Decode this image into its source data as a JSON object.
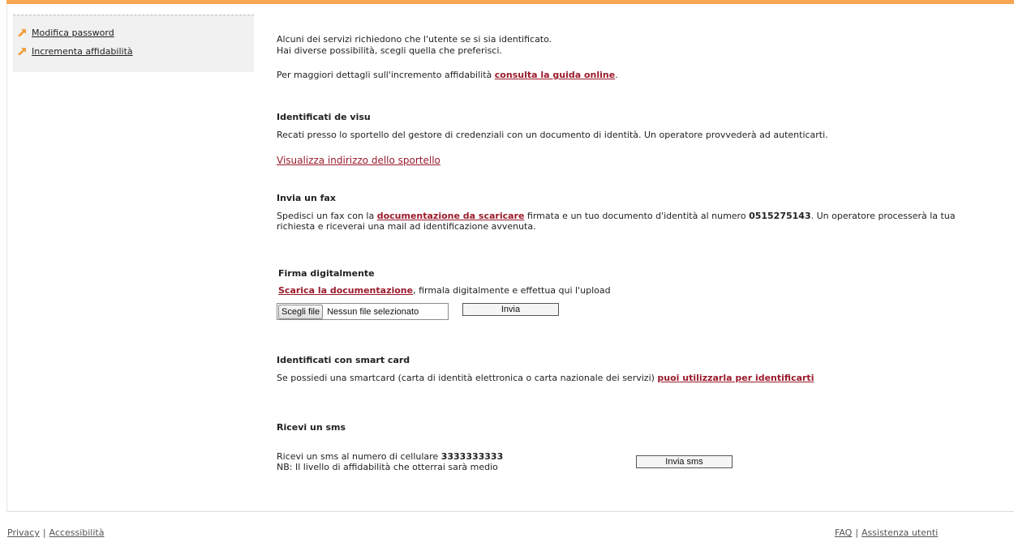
{
  "sidebar": {
    "items": [
      {
        "label": "Modifica password"
      },
      {
        "label": "Incrementa affidabilità"
      }
    ]
  },
  "intro": {
    "line1": "Alcuni dei servizi richiedono che l'utente se si sia identificato.",
    "line2": "Hai diverse possibilità, scegli quella che preferisci.",
    "guide_prefix": "Per maggiori dettagli sull'incremento affidabilità ",
    "guide_link": "consulta la guida online",
    "guide_suffix": "."
  },
  "visu": {
    "title": "Identificati de visu",
    "text": "Recati presso lo sportello del gestore di credenziali con un documento di identità. Un operatore provvederà ad autenticarti.",
    "link": "Visualizza indirizzo dello sportello"
  },
  "fax": {
    "title": "Invia un fax",
    "prefix": "Spedisci un fax con la ",
    "link": "documentazione da scaricare",
    "middle": " firmata e un tuo documento d'identità al numero ",
    "number": "0515275143",
    "suffix": ". Un operatore processerà la tua",
    "line2": "richiesta e riceverai una mail ad identificazione avvenuta."
  },
  "firma": {
    "title": "Firma digitalmente",
    "link": "Scarica la documentazione",
    "suffix": ", firmala digitalmente e effettua qui l'upload",
    "file_button": "Scegli file",
    "file_status": "Nessun file selezionato",
    "submit_label": "Invia"
  },
  "smartcard": {
    "title": "Identificati con smart card",
    "prefix": "Se possiedi una smartcard (carta di identità elettronica o carta nazionale dei servizi) ",
    "link": "puoi utilizzarla per identificarti"
  },
  "sms": {
    "title": "Ricevi un sms",
    "prefix": "Ricevi un sms al numero di cellulare ",
    "number": "3333333333",
    "note": "NB: Il livello di affidabilità che otterrai sarà medio",
    "button_label": "Invia sms"
  },
  "footer": {
    "privacy": "Privacy",
    "accessibility": "Accessibilità",
    "separator": "|",
    "faq": "FAQ",
    "support": "Assistenza utenti"
  },
  "colors": {
    "accent_bar": "#f7a654",
    "link": "#9b1b2c",
    "sidebar_bg": "#f1f1f1"
  }
}
